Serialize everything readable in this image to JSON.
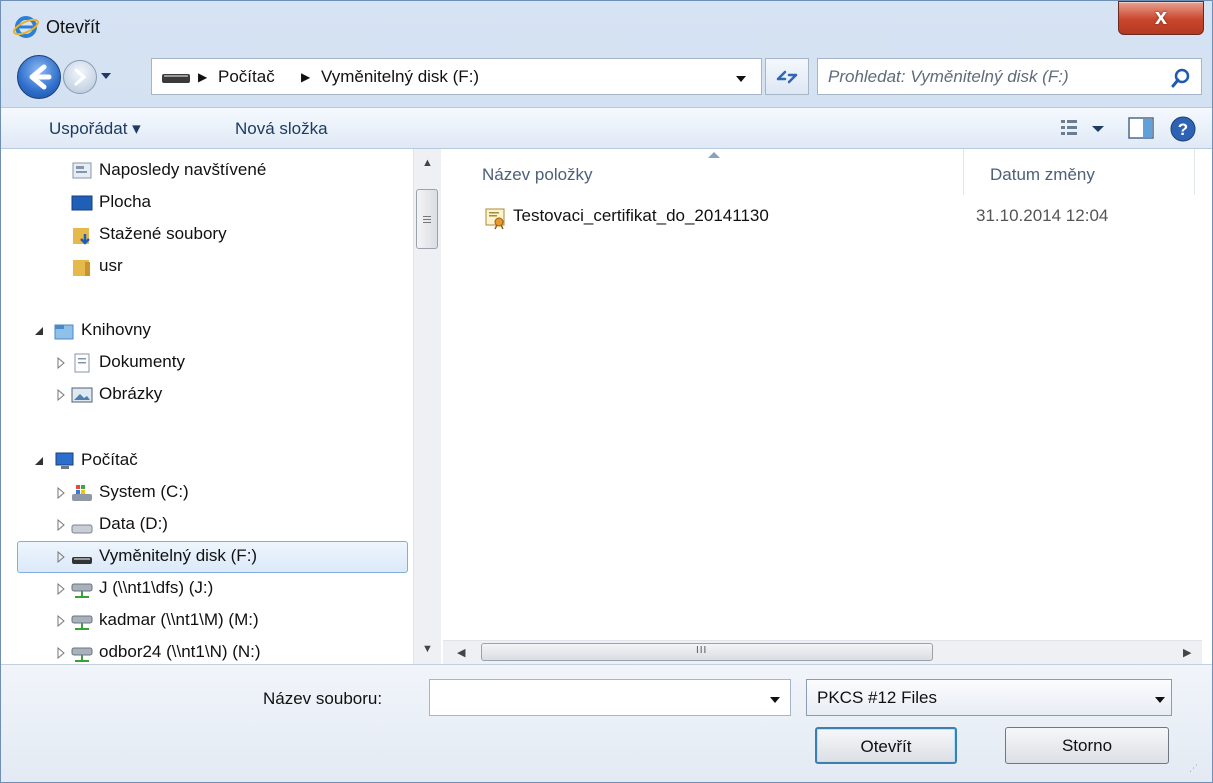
{
  "window": {
    "title": "Otevřít",
    "close_label": "x"
  },
  "address": {
    "breadcrumbs": [
      "Počítač",
      "Vyměnitelný disk (F:)"
    ],
    "search_placeholder": "Prohledat: Vyměnitelný disk (F:)"
  },
  "toolbar": {
    "organize_label": "Uspořádat ▾",
    "new_folder_label": "Nová složka"
  },
  "nav": {
    "favorites": [
      {
        "label": "Naposledy navštívené",
        "icon": "recent-places-icon"
      },
      {
        "label": "Plocha",
        "icon": "desktop-icon"
      },
      {
        "label": "Stažené soubory",
        "icon": "downloads-icon"
      },
      {
        "label": "usr",
        "icon": "user-folder-icon"
      }
    ],
    "libraries": {
      "label": "Knihovny",
      "items": [
        {
          "label": "Dokumenty",
          "icon": "documents-icon"
        },
        {
          "label": "Obrázky",
          "icon": "pictures-icon"
        }
      ]
    },
    "computer": {
      "label": "Počítač",
      "items": [
        {
          "label": "System (C:)",
          "icon": "system-drive-icon"
        },
        {
          "label": "Data (D:)",
          "icon": "drive-icon"
        },
        {
          "label": "Vyměnitelný disk (F:)",
          "icon": "removable-drive-icon",
          "selected": true
        },
        {
          "label": "J (\\\\nt1\\dfs) (J:)",
          "icon": "network-drive-icon"
        },
        {
          "label": "kadmar (\\\\nt1\\M) (M:)",
          "icon": "network-drive-icon"
        },
        {
          "label": "odbor24 (\\\\nt1\\N) (N:)",
          "icon": "network-drive-icon"
        }
      ]
    }
  },
  "files": {
    "columns": [
      "Název položky",
      "Datum změny"
    ],
    "rows": [
      {
        "name": "Testovaci_certifikat_do_20141130",
        "date": "31.10.2014 12:04",
        "icon": "certificate-icon"
      }
    ],
    "scroll_grip": "III"
  },
  "bottom": {
    "filename_label": "Název souboru:",
    "filename_value": "",
    "filetype": "PKCS #12 Files",
    "open_label": "Otevřít",
    "cancel_label": "Storno"
  },
  "colors": {
    "selection_border": "#84acdd",
    "close_red": "#c9462c",
    "header_text": "#4c607a"
  }
}
